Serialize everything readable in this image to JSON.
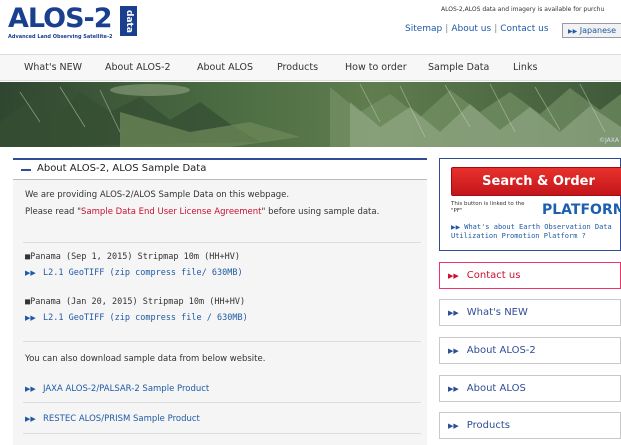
{
  "header": {
    "logo_text": "ALOS-2",
    "logo_badge": "data",
    "logo_subtitle": "Advanced Land Observing Satellite-2",
    "notice": "ALOS-2,ALOS data and imagery is available for purchu",
    "links": [
      "Sitemap",
      "About us",
      "Contact us"
    ],
    "lang_button": "Japanese"
  },
  "nav": {
    "items": [
      "What's NEW",
      "About ALOS-2",
      "About ALOS",
      "Products",
      "How to order",
      "Sample Data",
      "Links"
    ]
  },
  "banner": {
    "credit": "©JAXA"
  },
  "section": {
    "title": "About ALOS-2, ALOS Sample Data",
    "intro1": "We are providing ALOS-2/ALOS Sample Data on this webpage.",
    "intro2_before": "Please read \"",
    "intro2_link": "Sample Data End User License Agreement",
    "intro2_after": "\" before using sample data.",
    "samples": [
      {
        "title": "Panama (Sep 1, 2015) Stripmap 10m (HH+HV)",
        "link": "L2.1 GeoTIFF (zip compress file/ 630MB)"
      },
      {
        "title": "Panama (Jan 20, 2015) Stripmap 10m (HH+HV)",
        "link": "L2.1 GeoTIFF (zip compress file / 630MB)"
      }
    ],
    "also": "You can also download sample data from below website.",
    "external_links": [
      "JAXA ALOS-2/PALSAR-2 Sample Product",
      "RESTEC ALOS/PRISM Sample Product"
    ]
  },
  "sidebar": {
    "search_order": "Search & Order",
    "platform_note": "This button is linked to the \"PF\"",
    "platform_logo": "PLATFORM",
    "platform_link": "What's about Earth Observation Data Utilization Promotion Platform ?",
    "buttons": [
      "Contact us",
      "What's NEW",
      "About ALOS-2",
      "About ALOS",
      "Products"
    ]
  },
  "colors": {
    "brand_blue": "#1a3f8f",
    "accent_red": "#c8102e",
    "link_blue": "#1f5aa6"
  }
}
